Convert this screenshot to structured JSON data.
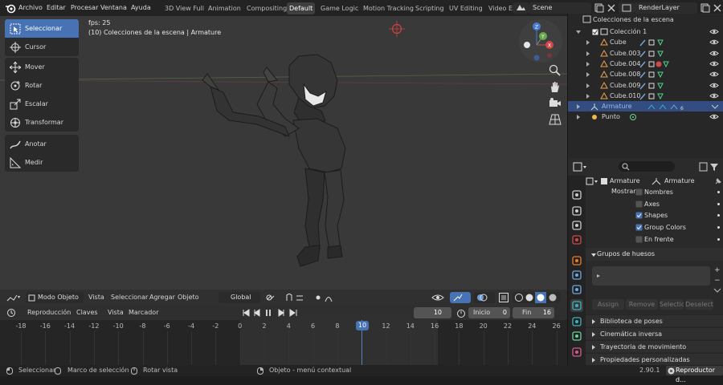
{
  "menus": [
    "Archivo",
    "Editar",
    "Procesar",
    "Ventana",
    "Ayuda"
  ],
  "workspaces": [
    "3D View Full",
    "Animation",
    "Compositing",
    "Default",
    "Game Logic",
    "Motion Tracking",
    "Scripting",
    "UV Editing",
    "Video E"
  ],
  "active_workspace": "Default",
  "scene": "Scene",
  "render_layer": "RenderLayer",
  "viewport": {
    "fps": "fps: 25",
    "info": "(10) Colecciones de la escena | Armature",
    "tools": [
      "Seleccionar (Marc...",
      "Cursor",
      "Mover",
      "Rotar",
      "Escalar",
      "Transformar",
      "Anotar",
      "Medir"
    ]
  },
  "header": {
    "mode": "Modo Objeto",
    "vista": "Vista",
    "seleccionar": "Seleccionar",
    "agregar": "Agregar",
    "objeto": "Objeto",
    "orientation": "Global"
  },
  "timeline": {
    "menu": [
      "Reproducción",
      "Claves",
      "Vista",
      "Marcador"
    ],
    "current_frame": "10",
    "start_label": "Inicio",
    "start": "0",
    "end_label": "Fin",
    "end": "16",
    "ticks": [
      "-18",
      "-16",
      "-14",
      "-12",
      "-10",
      "-8",
      "-6",
      "-4",
      "-2",
      "0",
      "2",
      "4",
      "6",
      "8",
      "10",
      "12",
      "14",
      "16",
      "18",
      "20",
      "22",
      "24",
      "26"
    ]
  },
  "status": {
    "select": "Seleccionar",
    "box": "Marco de selección",
    "rotate": "Rotar vista",
    "context": "Objeto - menú contextual",
    "version": "2.90.1",
    "player": "Reproductor d..."
  },
  "outliner": {
    "root": "Colecciones de la escena",
    "items": [
      {
        "name": "Colección 1",
        "indent": 1
      },
      {
        "name": "Cube",
        "indent": 2
      },
      {
        "name": "Cube.003",
        "indent": 2
      },
      {
        "name": "Cube.004",
        "indent": 2
      },
      {
        "name": "Cube.008",
        "indent": 2
      },
      {
        "name": "Cube.009",
        "indent": 2
      },
      {
        "name": "Cube.010",
        "indent": 2
      },
      {
        "name": "Armature",
        "indent": 1,
        "selected": true
      },
      {
        "name": "Punto",
        "indent": 1
      }
    ]
  },
  "properties": {
    "object_name": "Armature",
    "data_name": "Armature",
    "mostrar": "Mostrar",
    "checks": [
      {
        "label": "Nombres",
        "checked": false
      },
      {
        "label": "Axes",
        "checked": false
      },
      {
        "label": "Shapes",
        "checked": true
      },
      {
        "label": "Group Colors",
        "checked": true
      },
      {
        "label": "En frente",
        "checked": false
      }
    ],
    "bone_groups": "Grupos de huesos",
    "buttons": [
      "Assign",
      "Remove",
      "Selectio",
      "Deselect"
    ],
    "panels": [
      "Biblioteca de poses",
      "Cinemática inversa",
      "Trayectoria de movimiento",
      "Propiedades personalizadas"
    ]
  }
}
